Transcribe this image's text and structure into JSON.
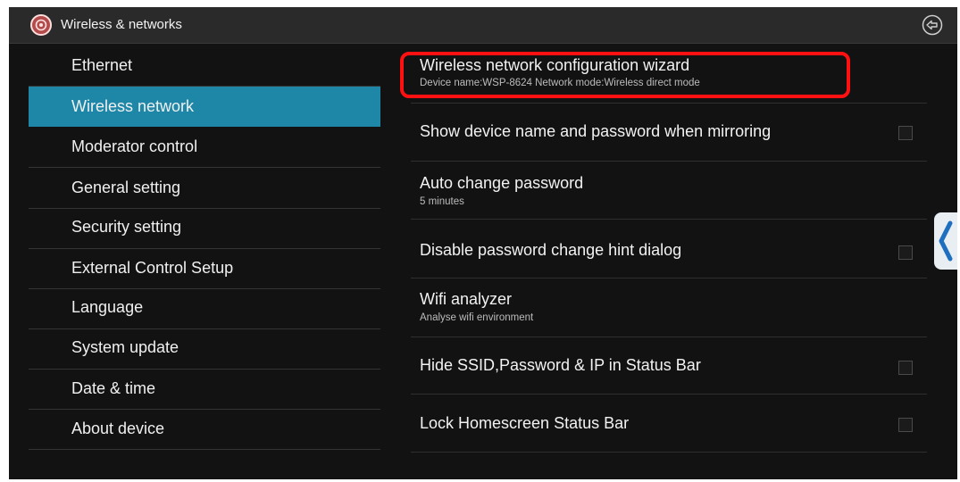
{
  "titlebar": {
    "title": "Wireless & networks",
    "app_icon": "settings-app-icon",
    "back_icon": "back-arrow-icon"
  },
  "nav": {
    "items": [
      {
        "label": "Ethernet",
        "active": false
      },
      {
        "label": "Wireless network",
        "active": true
      },
      {
        "label": "Moderator control",
        "active": false
      },
      {
        "label": "General setting",
        "active": false
      },
      {
        "label": "Security setting",
        "active": false
      },
      {
        "label": "External Control Setup",
        "active": false
      },
      {
        "label": "Language",
        "active": false
      },
      {
        "label": "System update",
        "active": false
      },
      {
        "label": "Date & time",
        "active": false
      },
      {
        "label": "About device",
        "active": false
      }
    ]
  },
  "settings": {
    "items": [
      {
        "title": "Wireless network configuration wizard",
        "subtitle": "Device name:WSP-8624   Network mode:Wireless direct mode",
        "checkbox": false
      },
      {
        "title": "Show device name and password when mirroring",
        "subtitle": "",
        "checkbox": true,
        "checked": false
      },
      {
        "title": "Auto change password",
        "subtitle": "5 minutes",
        "checkbox": false
      },
      {
        "title": "Disable password change hint dialog",
        "subtitle": "",
        "checkbox": true,
        "checked": false
      },
      {
        "title": "Wifi analyzer",
        "subtitle": "Analyse wifi environment",
        "checkbox": false
      },
      {
        "title": "Hide SSID,Password & IP in Status Bar",
        "subtitle": "",
        "checkbox": true,
        "checked": false
      },
      {
        "title": "Lock Homescreen Status Bar",
        "subtitle": "",
        "checkbox": true,
        "checked": false
      }
    ]
  },
  "colors": {
    "accent": "#1e87a8",
    "highlight": "#ff1111",
    "background": "#121212",
    "titlebar": "#2a2a2a"
  }
}
